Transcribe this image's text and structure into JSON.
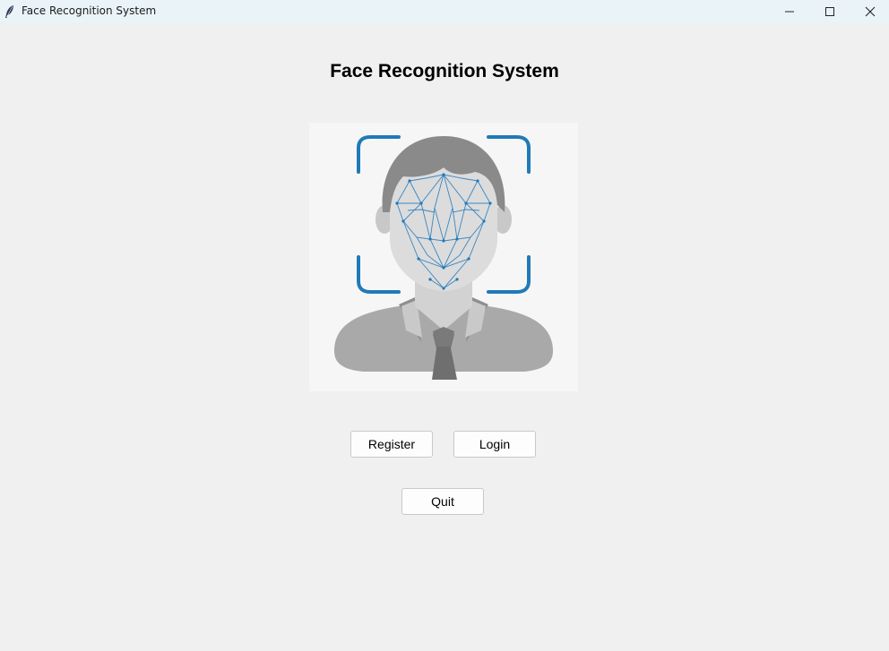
{
  "window": {
    "title": "Face Recognition System",
    "icons": {
      "app": "feather-icon",
      "minimize": "minimize-icon",
      "maximize": "maximize-icon",
      "close": "close-icon"
    }
  },
  "main": {
    "heading": "Face Recognition System",
    "illustration": "face-recognition-icon",
    "buttons": {
      "register": "Register",
      "login": "Login",
      "quit": "Quit"
    }
  },
  "colors": {
    "accent": "#1f7ab8",
    "background": "#f0f0f0",
    "titlebar": "#eaf4f8"
  }
}
